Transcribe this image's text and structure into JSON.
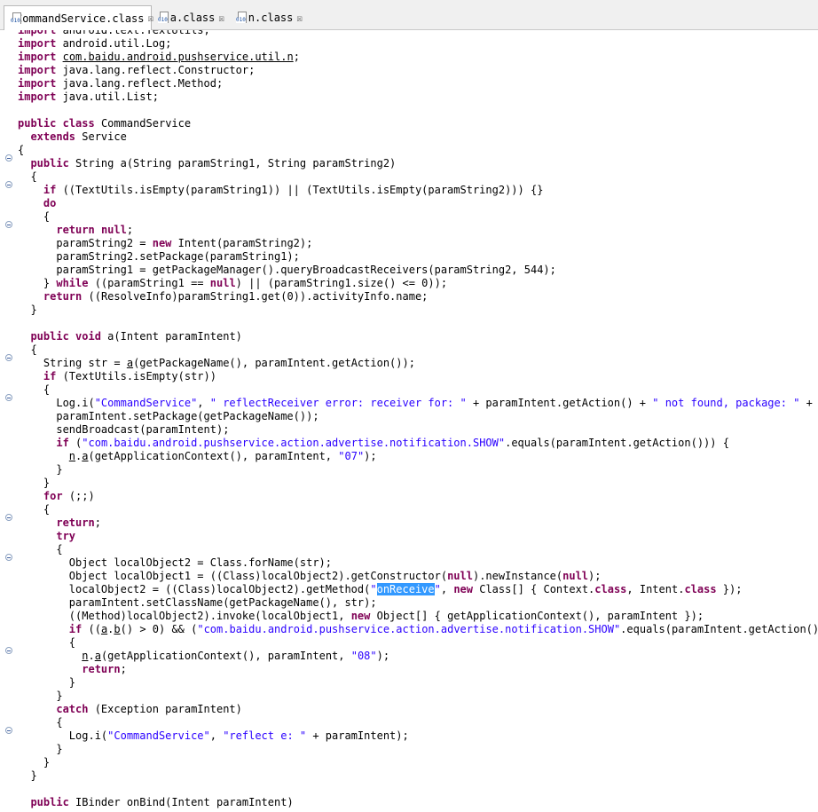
{
  "tabs": [
    {
      "label": "CommandService.class",
      "icon": "class-file-icon",
      "active": true
    },
    {
      "label": "a.class",
      "icon": "class-file-icon",
      "active": false
    },
    {
      "label": "n.class",
      "icon": "class-file-icon",
      "active": false
    }
  ],
  "close_glyph": "☒",
  "code_lines": [
    [
      [
        "kw",
        "import"
      ],
      [
        "t",
        " android.text.TextUtils;"
      ]
    ],
    [
      [
        "kw",
        "import"
      ],
      [
        "t",
        " android.util.Log;"
      ]
    ],
    [
      [
        "kw",
        "import"
      ],
      [
        "t",
        " "
      ],
      [
        "ul",
        "com.baidu.android.pushservice.util.n"
      ],
      [
        "t",
        ";"
      ]
    ],
    [
      [
        "kw",
        "import"
      ],
      [
        "t",
        " java.lang.reflect.Constructor;"
      ]
    ],
    [
      [
        "kw",
        "import"
      ],
      [
        "t",
        " java.lang.reflect.Method;"
      ]
    ],
    [
      [
        "kw",
        "import"
      ],
      [
        "t",
        " java.util.List;"
      ]
    ],
    [],
    [
      [
        "kw",
        "public"
      ],
      [
        "t",
        " "
      ],
      [
        "kw",
        "class"
      ],
      [
        "t",
        " CommandService"
      ]
    ],
    [
      [
        "t",
        "  "
      ],
      [
        "kw",
        "extends"
      ],
      [
        "t",
        " Service"
      ]
    ],
    [
      [
        "t",
        "{"
      ]
    ],
    [
      [
        "t",
        "  "
      ],
      [
        "kw",
        "public"
      ],
      [
        "t",
        " String a(String paramString1, String paramString2)"
      ]
    ],
    [
      [
        "t",
        "  {"
      ]
    ],
    [
      [
        "t",
        "    "
      ],
      [
        "kw",
        "if"
      ],
      [
        "t",
        " ((TextUtils.isEmpty(paramString1)) || (TextUtils.isEmpty(paramString2))) {}"
      ]
    ],
    [
      [
        "t",
        "    "
      ],
      [
        "kw",
        "do"
      ]
    ],
    [
      [
        "t",
        "    {"
      ]
    ],
    [
      [
        "t",
        "      "
      ],
      [
        "kw",
        "return"
      ],
      [
        "t",
        " "
      ],
      [
        "kw",
        "null"
      ],
      [
        "t",
        ";"
      ]
    ],
    [
      [
        "t",
        "      paramString2 = "
      ],
      [
        "kw",
        "new"
      ],
      [
        "t",
        " Intent(paramString2);"
      ]
    ],
    [
      [
        "t",
        "      paramString2.setPackage(paramString1);"
      ]
    ],
    [
      [
        "t",
        "      paramString1 = getPackageManager().queryBroadcastReceivers(paramString2, 544);"
      ]
    ],
    [
      [
        "t",
        "    } "
      ],
      [
        "kw",
        "while"
      ],
      [
        "t",
        " ((paramString1 == "
      ],
      [
        "kw",
        "null"
      ],
      [
        "t",
        ") || (paramString1.size() <= 0));"
      ]
    ],
    [
      [
        "t",
        "    "
      ],
      [
        "kw",
        "return"
      ],
      [
        "t",
        " ((ResolveInfo)paramString1.get(0)).activityInfo.name;"
      ]
    ],
    [
      [
        "t",
        "  }"
      ]
    ],
    [],
    [
      [
        "t",
        "  "
      ],
      [
        "kw",
        "public"
      ],
      [
        "t",
        " "
      ],
      [
        "kw",
        "void"
      ],
      [
        "t",
        " a(Intent paramIntent)"
      ]
    ],
    [
      [
        "t",
        "  {"
      ]
    ],
    [
      [
        "t",
        "    String str = "
      ],
      [
        "ul",
        "a"
      ],
      [
        "t",
        "(getPackageName(), paramIntent.getAction());"
      ]
    ],
    [
      [
        "t",
        "    "
      ],
      [
        "kw",
        "if"
      ],
      [
        "t",
        " (TextUtils.isEmpty(str))"
      ]
    ],
    [
      [
        "t",
        "    {"
      ]
    ],
    [
      [
        "t",
        "      Log.i("
      ],
      [
        "str",
        "\"CommandService\""
      ],
      [
        "t",
        ", "
      ],
      [
        "str",
        "\" reflectReceiver error: receiver for: \""
      ],
      [
        "t",
        " + paramIntent.getAction() + "
      ],
      [
        "str",
        "\" not found, package: \""
      ],
      [
        "t",
        " + getPackageName());"
      ]
    ],
    [
      [
        "t",
        "      paramIntent.setPackage(getPackageName());"
      ]
    ],
    [
      [
        "t",
        "      sendBroadcast(paramIntent);"
      ]
    ],
    [
      [
        "t",
        "      "
      ],
      [
        "kw",
        "if"
      ],
      [
        "t",
        " ("
      ],
      [
        "str",
        "\"com.baidu.android.pushservice.action.advertise.notification.SHOW\""
      ],
      [
        "t",
        ".equals(paramIntent.getAction())) {"
      ]
    ],
    [
      [
        "t",
        "        "
      ],
      [
        "ul",
        "n"
      ],
      [
        "t",
        "."
      ],
      [
        "ul",
        "a"
      ],
      [
        "t",
        "(getApplicationContext(), paramIntent, "
      ],
      [
        "str",
        "\"07\""
      ],
      [
        "t",
        ");"
      ]
    ],
    [
      [
        "t",
        "      }"
      ]
    ],
    [
      [
        "t",
        "    }"
      ]
    ],
    [
      [
        "t",
        "    "
      ],
      [
        "kw",
        "for"
      ],
      [
        "t",
        " (;;)"
      ]
    ],
    [
      [
        "t",
        "    {"
      ]
    ],
    [
      [
        "t",
        "      "
      ],
      [
        "kw",
        "return"
      ],
      [
        "t",
        ";"
      ]
    ],
    [
      [
        "t",
        "      "
      ],
      [
        "kw",
        "try"
      ]
    ],
    [
      [
        "t",
        "      {"
      ]
    ],
    [
      [
        "t",
        "        Object localObject2 = Class.forName(str);"
      ]
    ],
    [
      [
        "t",
        "        Object localObject1 = ((Class)localObject2).getConstructor("
      ],
      [
        "kw",
        "null"
      ],
      [
        "t",
        ").newInstance("
      ],
      [
        "kw",
        "null"
      ],
      [
        "t",
        ");"
      ]
    ],
    [
      [
        "t",
        "        localObject2 = ((Class)localObject2).getMethod("
      ],
      [
        "str",
        "\""
      ],
      [
        "sel",
        "onReceive"
      ],
      [
        "str",
        "\""
      ],
      [
        "t",
        ", "
      ],
      [
        "kw",
        "new"
      ],
      [
        "t",
        " Class[] { Context."
      ],
      [
        "kw",
        "class"
      ],
      [
        "t",
        ", Intent."
      ],
      [
        "kw",
        "class"
      ],
      [
        "t",
        " });"
      ]
    ],
    [
      [
        "t",
        "        paramIntent.setClassName(getPackageName(), str);"
      ]
    ],
    [
      [
        "t",
        "        ((Method)localObject2).invoke(localObject1, "
      ],
      [
        "kw",
        "new"
      ],
      [
        "t",
        " Object[] { getApplicationContext(), paramIntent });"
      ]
    ],
    [
      [
        "t",
        "        "
      ],
      [
        "kw",
        "if"
      ],
      [
        "t",
        " (("
      ],
      [
        "ul",
        "a"
      ],
      [
        "t",
        "."
      ],
      [
        "ul",
        "b"
      ],
      [
        "t",
        "() > 0) && ("
      ],
      [
        "str",
        "\"com.baidu.android.pushservice.action.advertise.notification.SHOW\""
      ],
      [
        "t",
        ".equals(paramIntent.getAction())))"
      ]
    ],
    [
      [
        "t",
        "        {"
      ]
    ],
    [
      [
        "t",
        "          "
      ],
      [
        "ul",
        "n"
      ],
      [
        "t",
        "."
      ],
      [
        "ul",
        "a"
      ],
      [
        "t",
        "(getApplicationContext(), paramIntent, "
      ],
      [
        "str",
        "\"08\""
      ],
      [
        "t",
        ");"
      ]
    ],
    [
      [
        "t",
        "          "
      ],
      [
        "kw",
        "return"
      ],
      [
        "t",
        ";"
      ]
    ],
    [
      [
        "t",
        "        }"
      ]
    ],
    [
      [
        "t",
        "      }"
      ]
    ],
    [
      [
        "t",
        "      "
      ],
      [
        "kw",
        "catch"
      ],
      [
        "t",
        " (Exception paramIntent)"
      ]
    ],
    [
      [
        "t",
        "      {"
      ]
    ],
    [
      [
        "t",
        "        Log.i("
      ],
      [
        "str",
        "\"CommandService\""
      ],
      [
        "t",
        ", "
      ],
      [
        "str",
        "\"reflect e: \""
      ],
      [
        "t",
        " + paramIntent);"
      ]
    ],
    [
      [
        "t",
        "      }"
      ]
    ],
    [
      [
        "t",
        "    }"
      ]
    ],
    [
      [
        "t",
        "  }"
      ]
    ],
    [],
    [
      [
        "t",
        "  "
      ],
      [
        "kw",
        "public"
      ],
      [
        "t",
        " IBinder onBind(Intent paramIntent)"
      ]
    ]
  ]
}
